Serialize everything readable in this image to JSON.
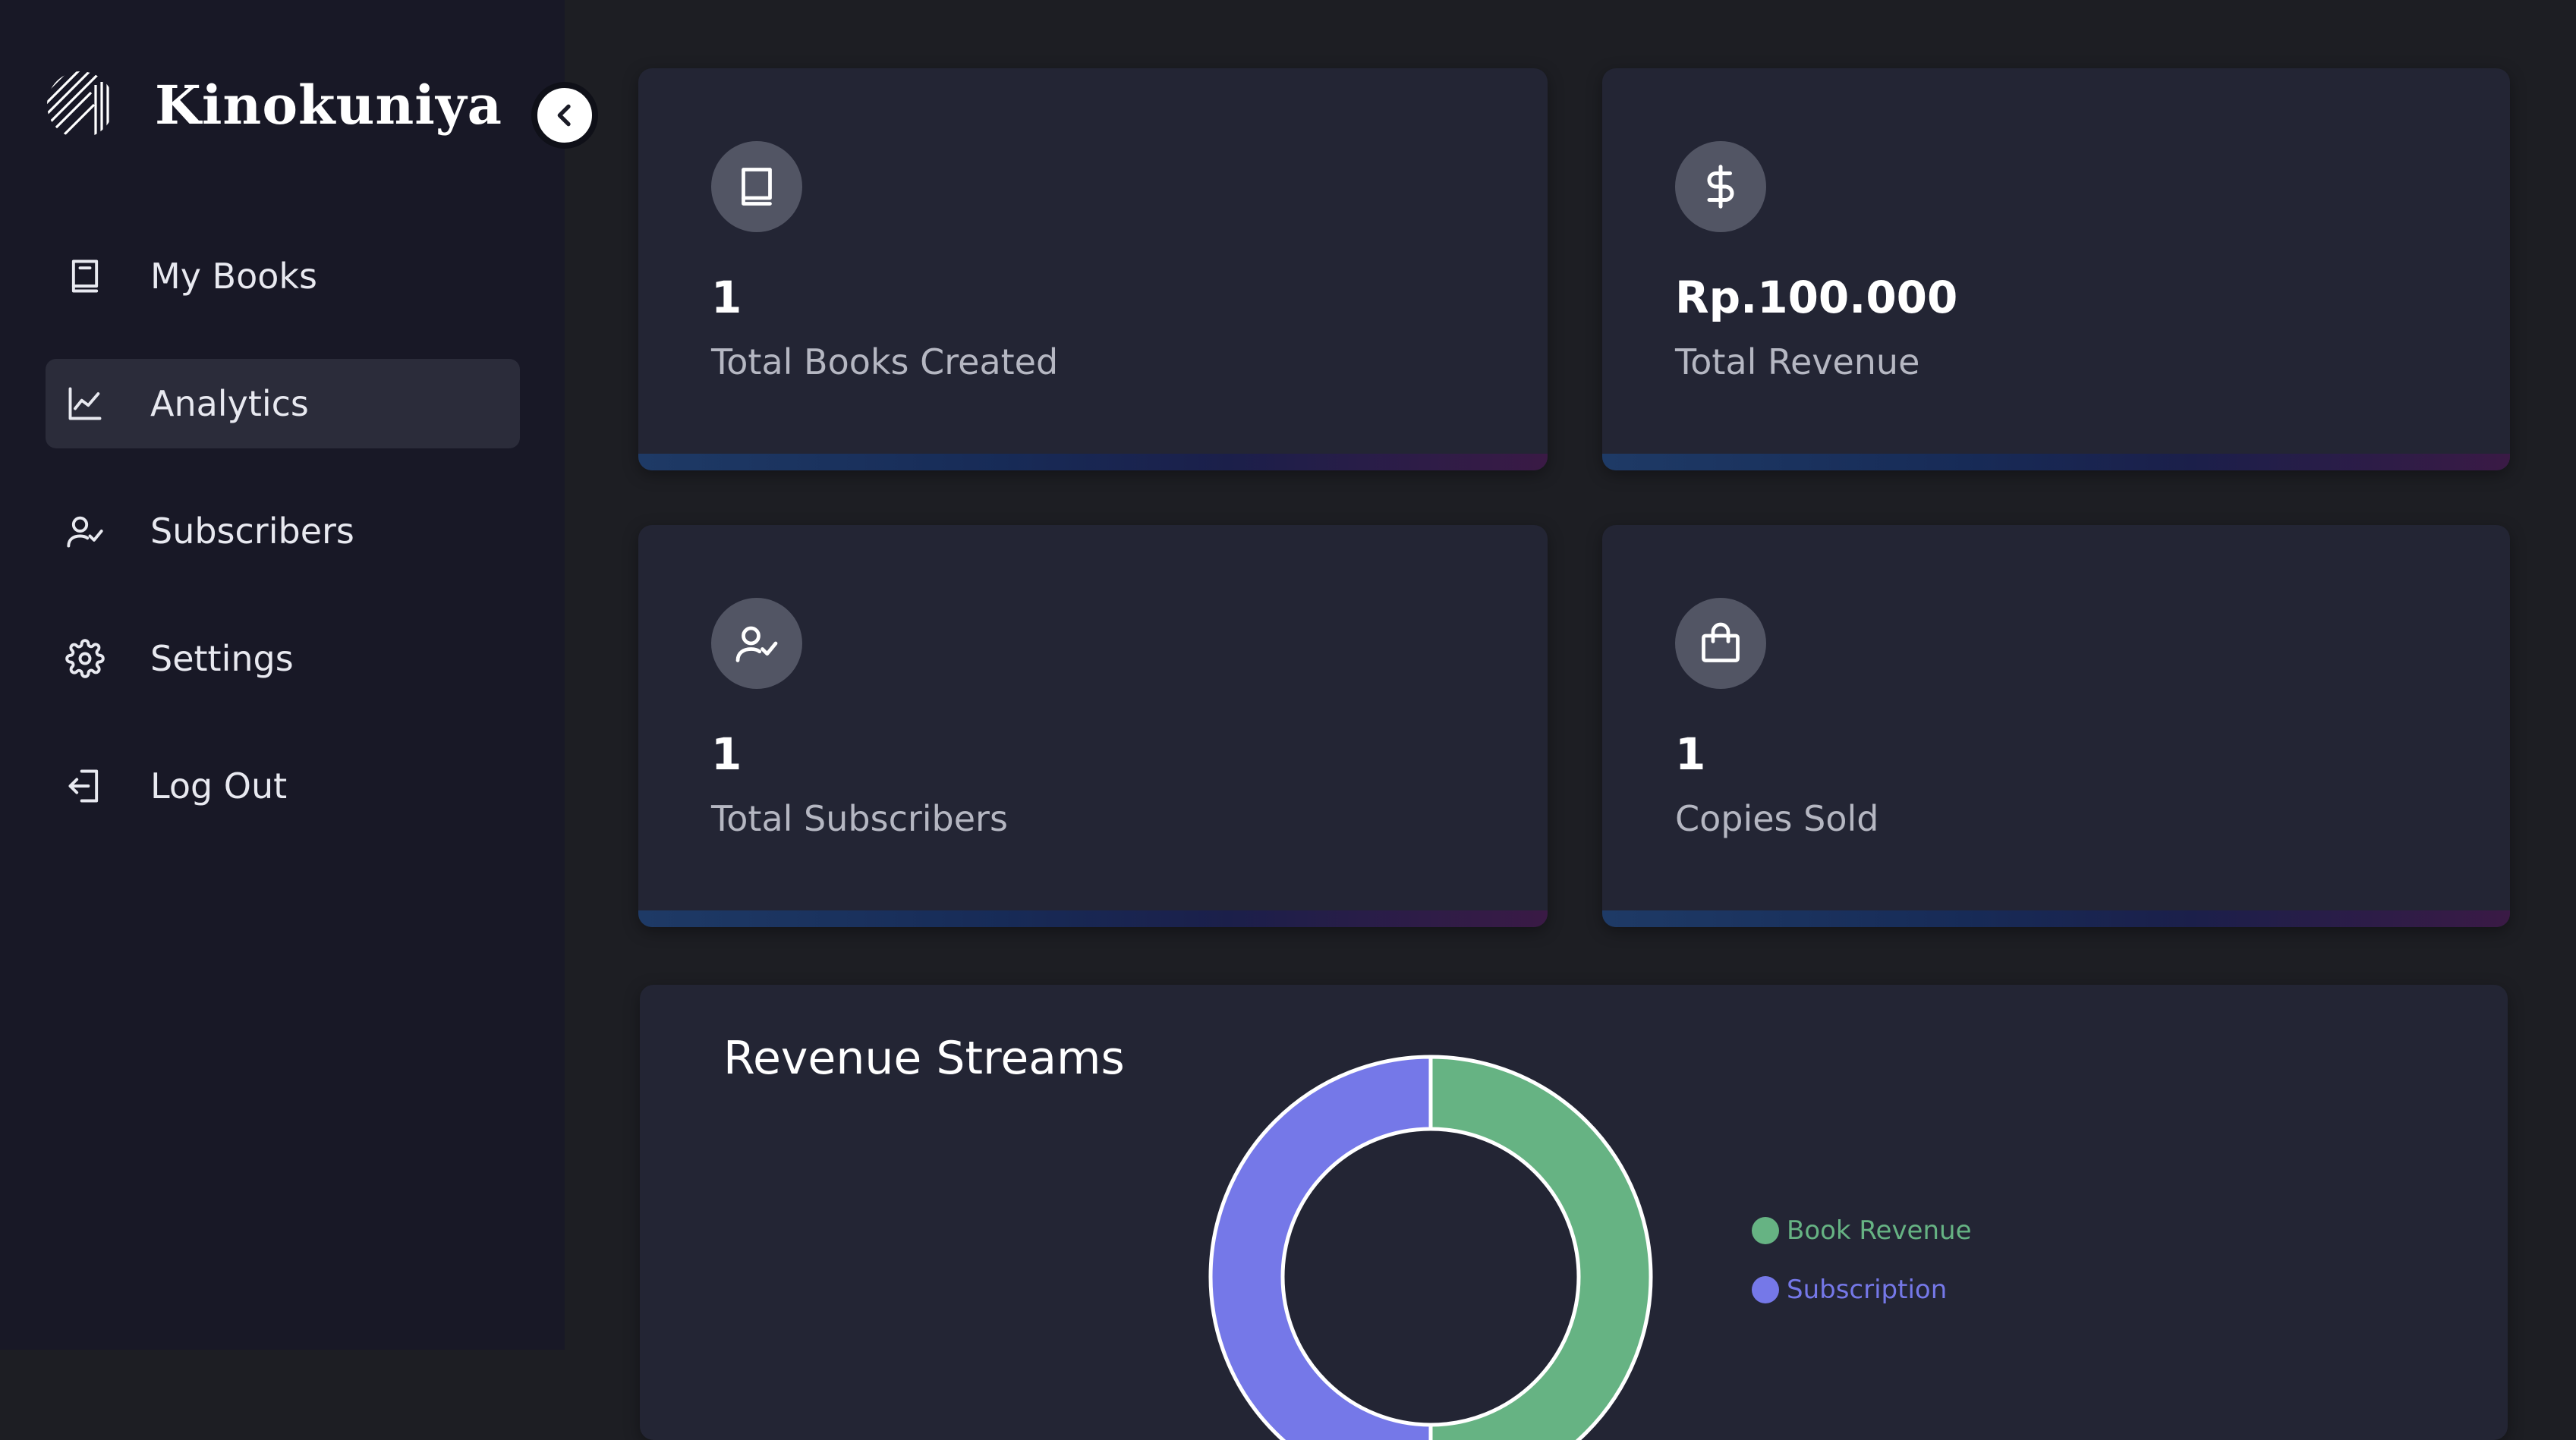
{
  "brand": {
    "name": "Kinokuniya"
  },
  "sidebar": {
    "items": [
      {
        "label": "My Books",
        "icon": "book-icon",
        "active": false
      },
      {
        "label": "Analytics",
        "icon": "chart-line-icon",
        "active": true
      },
      {
        "label": "Subscribers",
        "icon": "user-check-icon",
        "active": false
      },
      {
        "label": "Settings",
        "icon": "gear-icon",
        "active": false
      },
      {
        "label": "Log Out",
        "icon": "logout-icon",
        "active": false
      }
    ]
  },
  "stats": [
    {
      "value": "1",
      "label": "Total Books Created",
      "icon": "book-icon"
    },
    {
      "value": "Rp.100.000",
      "label": "Total Revenue",
      "icon": "dollar-icon"
    },
    {
      "value": "1",
      "label": "Total Subscribers",
      "icon": "user-check-icon"
    },
    {
      "value": "1",
      "label": "Copies Sold",
      "icon": "shopping-bag-icon"
    }
  ],
  "revenue": {
    "title": "Revenue Streams",
    "chart_data": {
      "type": "pie",
      "title": "Revenue Streams",
      "variant": "doughnut",
      "legend": "right",
      "series": [
        {
          "name": "Book Revenue",
          "value": 50,
          "color": "#66b383"
        },
        {
          "name": "Subscription",
          "value": 50,
          "color": "#7578e8"
        }
      ]
    }
  },
  "colors": {
    "background": "#1d1e23",
    "sidebar": "#181826",
    "card": "#232534",
    "icon_circle": "#525564",
    "book_revenue": "#66b383",
    "subscription": "#7578e8"
  }
}
